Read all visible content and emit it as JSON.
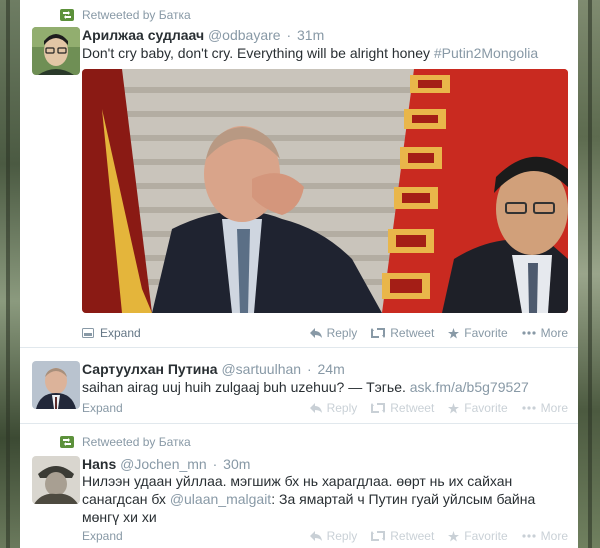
{
  "tweets": [
    {
      "context_label": "Retweeted by Батка",
      "fullname": "Арилжаа судлаач",
      "username": "@odbayare",
      "time": "31m",
      "text": "Don't cry baby, don't cry. Everything will be alright honey",
      "hashtag": "#Putin2Mongolia",
      "actions": {
        "expand": "Expand",
        "reply": "Reply",
        "retweet": "Retweet",
        "favorite": "Favorite",
        "more": "More"
      }
    },
    {
      "fullname": "Сартуулхан Путина",
      "username": "@sartuulhan",
      "time": "24m",
      "text": "saihan airag uuj  huih zulgaaj buh  uzehuu? — Тэгье.",
      "link": "ask.fm/a/b5g79527",
      "actions": {
        "expand": "Expand",
        "reply": "Reply",
        "retweet": "Retweet",
        "favorite": "Favorite",
        "more": "More"
      }
    },
    {
      "context_label": "Retweeted by Батка",
      "fullname": "Hans",
      "username": "@Jochen_mn",
      "time": "30m",
      "text_a": "Нилээн удаан уйллаа. мэгшиж бх нь харагдлаа. өөрт нь их сайхан санагдсан бх",
      "mention": "@ulaan_malgait",
      "text_b": ": За ямартай ч Путин гуай уйлсым байна мөнгү хи хи",
      "actions": {
        "expand": "Expand",
        "reply": "Reply",
        "retweet": "Retweet",
        "favorite": "Favorite",
        "more": "More"
      }
    }
  ],
  "colors": {
    "accent_muted": "#8899a6",
    "retweet_green": "#5c913b",
    "carpet_red": "#c92a20",
    "carpet_gold": "#e9b64a"
  },
  "icons": [
    "retweet-icon",
    "expand-icon",
    "reply-icon",
    "favorite-icon",
    "more-icon"
  ]
}
